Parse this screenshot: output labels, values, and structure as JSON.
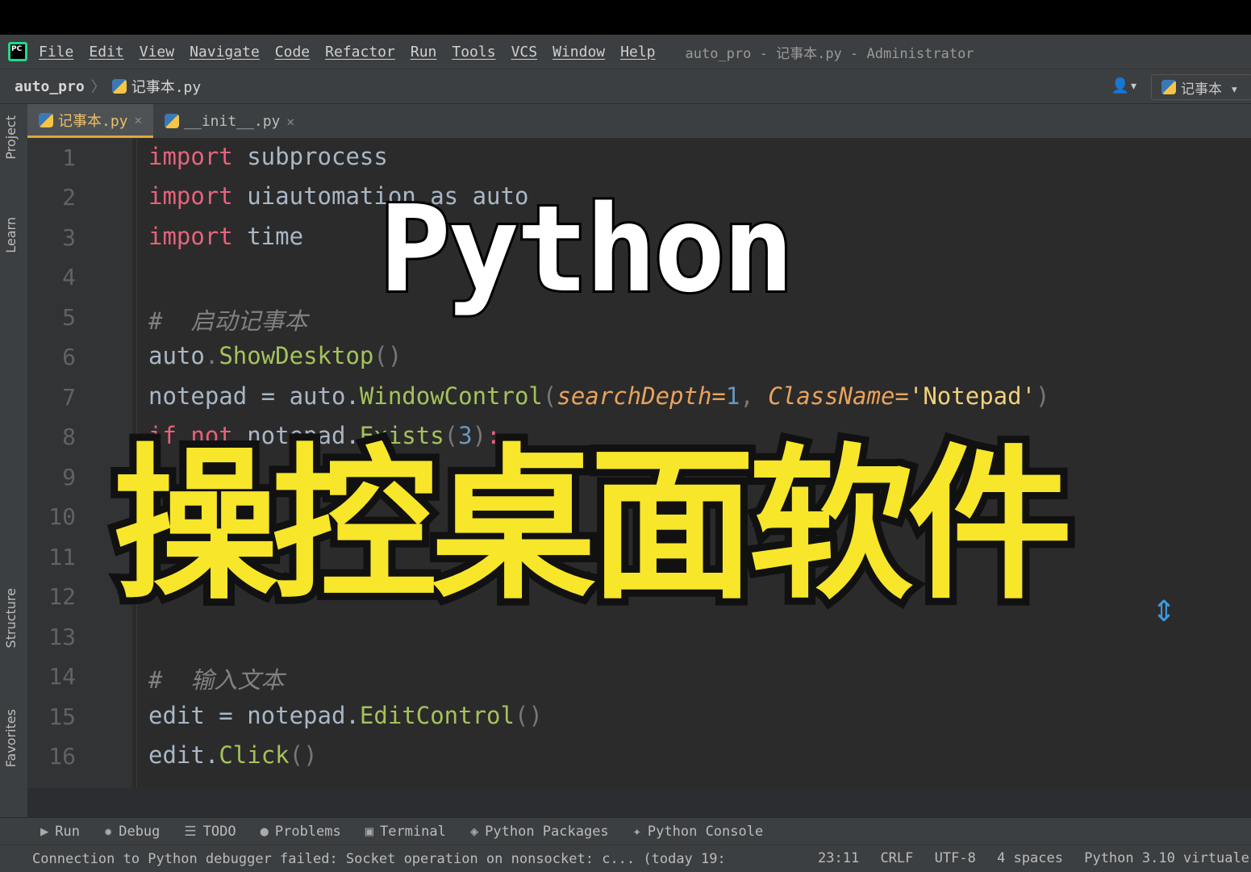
{
  "menubar": {
    "logo_text": "PC",
    "items": [
      "File",
      "Edit",
      "View",
      "Navigate",
      "Code",
      "Refactor",
      "Run",
      "Tools",
      "VCS",
      "Window",
      "Help"
    ],
    "window_title": "auto_pro - 记事本.py - Administrator"
  },
  "navbar": {
    "project": "auto_pro",
    "file": "记事本.py",
    "user_icon": "👤▾",
    "run_config": "记事本 ▾"
  },
  "side_tabs": [
    "Project",
    "Learn",
    "Structure",
    "Favorites"
  ],
  "tabs": [
    {
      "label": "记事本.py",
      "active": true
    },
    {
      "label": "__init__.py",
      "active": false
    }
  ],
  "code": {
    "line_numbers": [
      "1",
      "2",
      "3",
      "4",
      "5",
      "6",
      "7",
      "8",
      "9",
      "10",
      "11",
      "12",
      "13",
      "14",
      "15",
      "16"
    ],
    "lines": {
      "l1_kw": "import",
      "l1_rest": " subprocess",
      "l2_kw": "import",
      "l2_rest": " uiautomation as auto",
      "l3_kw": "import",
      "l3_rest": " time",
      "l5": "#  启动记事本",
      "l6_obj": "auto",
      "l6_fn": "ShowDesktop",
      "l6_paren": "()",
      "l7_a": "notepad = auto.",
      "l7_fn": "WindowControl",
      "l7_p1": "searchDepth",
      "l7_n": "1",
      "l7_p2": "ClassName",
      "l7_s": "'Notepad'",
      "l8_kw": "if not",
      "l8_a": " notepad.",
      "l8_fn": "Exists",
      "l8_n": "3",
      "l14": "#  输入文本",
      "l15_a": "edit = notepad.",
      "l15_fn": "EditControl",
      "l15_p": "()",
      "l16_a": "edit.",
      "l16_fn": "Click",
      "l16_p": "()"
    }
  },
  "overlay": {
    "title_en": "Python",
    "title_cn": "操控桌面软件"
  },
  "tool_windows": [
    {
      "icon": "▶",
      "label": "Run"
    },
    {
      "icon": "✹",
      "label": "Debug"
    },
    {
      "icon": "☰",
      "label": "TODO"
    },
    {
      "icon": "●",
      "label": "Problems"
    },
    {
      "icon": "▣",
      "label": "Terminal"
    },
    {
      "icon": "◈",
      "label": "Python Packages"
    },
    {
      "icon": "✦",
      "label": "Python Console"
    }
  ],
  "status": {
    "message": "Connection to Python debugger failed: Socket operation on nonsocket: c... (today 19:",
    "position": "23:11",
    "line_sep": "CRLF",
    "encoding": "UTF-8",
    "indent": "4 spaces",
    "interpreter": "Python 3.10 virtuale"
  },
  "colors": {
    "keyword": "#e8627b",
    "function": "#a5c25c",
    "string": "#f0d27a",
    "overlay_cn": "#f7e62a",
    "active_tab_underline": "#e2a53b"
  }
}
